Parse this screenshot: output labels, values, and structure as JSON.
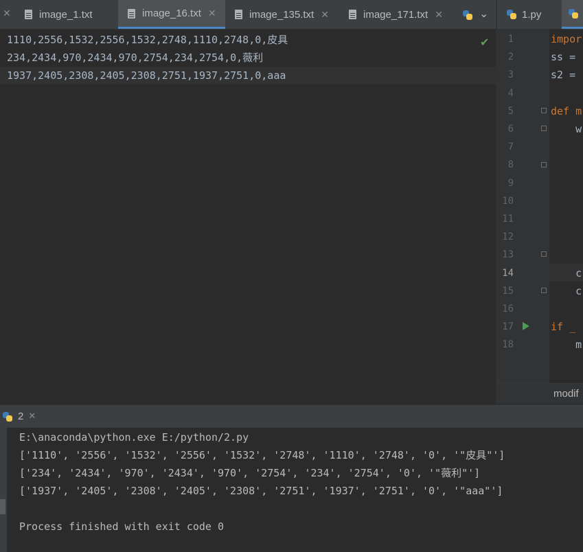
{
  "left_tabs": [
    {
      "label": "image_1.txt",
      "active": false
    },
    {
      "label": "image_16.txt",
      "active": true
    },
    {
      "label": "image_135.txt",
      "active": false
    },
    {
      "label": "image_171.txt",
      "active": false
    }
  ],
  "right_tabs": [
    {
      "label": "1.py"
    }
  ],
  "left_editor": {
    "lines": [
      "1110,2556,1532,2556,1532,2748,1110,2748,0,皮具",
      "234,2434,970,2434,970,2754,234,2754,0,薇利",
      "1937,2405,2308,2405,2308,2751,1937,2751,0,aaa"
    ]
  },
  "right_editor": {
    "line_numbers": [
      "1",
      "2",
      "3",
      "4",
      "5",
      "6",
      "7",
      "8",
      "9",
      "10",
      "11",
      "12",
      "13",
      "14",
      "15",
      "16",
      "17",
      "18"
    ],
    "code_fragments": [
      {
        "line": 1,
        "text": "impor",
        "kw": true
      },
      {
        "line": 2,
        "text": "ss =",
        "kw": false
      },
      {
        "line": 3,
        "text": "s2 =",
        "kw": false
      },
      {
        "line": 5,
        "text": "def m",
        "kw": true
      },
      {
        "line": 6,
        "text": "    w",
        "kw": false
      },
      {
        "line": 14,
        "text": "    c",
        "kw": false
      },
      {
        "line": 15,
        "text": "    c",
        "kw": false
      },
      {
        "line": 17,
        "text": "if _",
        "kw": true
      },
      {
        "line": 18,
        "text": "    m",
        "kw": false
      }
    ],
    "breadcrumb": "modif"
  },
  "run_panel": {
    "tab_label": "2",
    "output": [
      "E:\\anaconda\\python.exe E:/python/2.py",
      "['1110', '2556', '1532', '2556', '1532', '2748', '1110', '2748', '0', '\"皮具\"']",
      "['234', '2434', '970', '2434', '970', '2754', '234', '2754', '0', '\"薇利\"']",
      "['1937', '2405', '2308', '2405', '2308', '2751', '1937', '2751', '0', '\"aaa\"']",
      "",
      "Process finished with exit code 0"
    ]
  },
  "colors": {
    "background": "#2b2b2b",
    "keyword": "#cc7832",
    "check": "#5f9e58",
    "active_tab_underline": "#4a88c7"
  }
}
